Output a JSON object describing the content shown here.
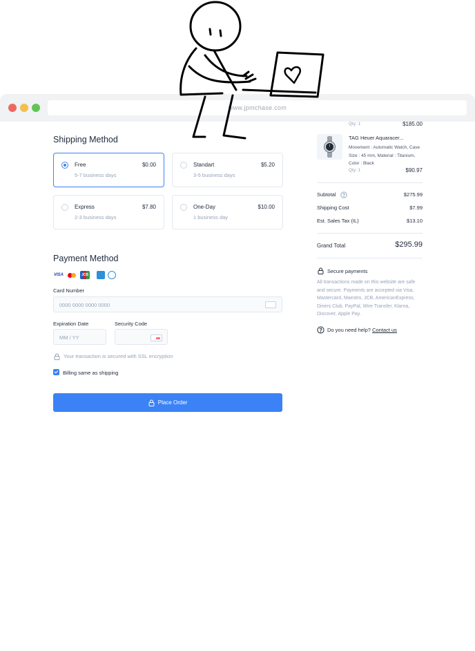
{
  "browser": {
    "url": "www.jpmchase.com"
  },
  "shipping": {
    "title": "Shipping Method",
    "options": [
      {
        "name": "Free",
        "price": "$0.00",
        "days": "5-7 business days",
        "selected": true
      },
      {
        "name": "Standart",
        "price": "$5.20",
        "days": "3-5 business days",
        "selected": false
      },
      {
        "name": "Express",
        "price": "$7.80",
        "days": "2-3 business days",
        "selected": false
      },
      {
        "name": "One-Day",
        "price": "$10.00",
        "days": "1 business day",
        "selected": false
      }
    ]
  },
  "payment": {
    "title": "Payment Method",
    "card_logos": [
      "VISA",
      "mastercard",
      "JCB",
      "amex",
      "diners"
    ],
    "card_number_label": "Card Number",
    "card_number_placeholder": "0000 0000 0000 0000",
    "expiration_label": "Expiration Date",
    "expiration_placeholder": "MM / YY",
    "security_label": "Security Code",
    "security_placeholder": "",
    "secure_note": "Your transaction is secured with SSL encryption",
    "billing_same": "Billing same as shipping",
    "billing_checked": true,
    "place_order": "Place Order"
  },
  "order": {
    "items": [
      {
        "qty": "Qty: 1",
        "price": "$185.00"
      },
      {
        "name": "TAG Heuer Aquaracer...",
        "desc": "Movement : Automatic Watch, Case Size : 45 mm, Material : Titanium, Color : Black",
        "qty": "Qty: 1",
        "price": "$90.97"
      }
    ],
    "subtotal_label": "Subtotal",
    "subtotal": "$275.99",
    "shipping_label": "Shipping Cost",
    "shipping": "$7.99",
    "tax_label": "Est. Sales Tax (IL)",
    "tax": "$13.10",
    "grand_label": "Grand Total",
    "grand": "$295.99",
    "secure_title": "Secure payments",
    "secure_text": "All transactions made on this website are safe and secure. Payments are accepted via Visa, Mastercard, Maestro, JCB, AmericanExpress, Diners Club, PayPal, Wire Transfer, Klarna, Discover, Apple Pay.",
    "help_text": "Do you need help?",
    "help_link": "Contact us"
  },
  "colors": {
    "accent": "#3b82f6",
    "text": "#1e293b",
    "muted": "#94a3b8",
    "border": "#e2e8f0"
  }
}
